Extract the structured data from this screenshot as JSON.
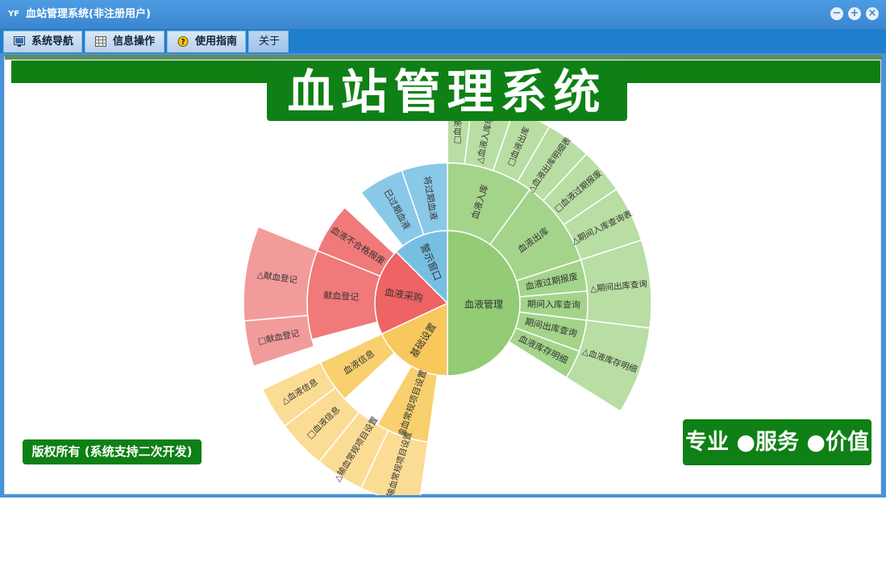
{
  "window": {
    "title": "血站管理系统(非注册用户)",
    "icon": "app-logo-icon"
  },
  "menu": [
    {
      "label": "系统导航",
      "icon": "monitor-icon"
    },
    {
      "label": "信息操作",
      "icon": "grid-icon"
    },
    {
      "label": "使用指南",
      "icon": "help-icon"
    },
    {
      "label": "关于",
      "icon": ""
    }
  ],
  "banner": {
    "title": "血站管理系统"
  },
  "footer": {
    "copyright": "版权所有 (系统支持二次开发)",
    "slogan": "专业 ●服务 ●价值"
  },
  "colors": {
    "green": "#0f8015",
    "titlebar": "#3a86cf",
    "menubar": "#1f7fcf"
  },
  "sunburst": {
    "rings": [
      {
        "level": 1,
        "segments": [
          {
            "label": "血液管理",
            "color": "#93cc74"
          },
          {
            "label": "基础设置",
            "color": "#f8c85c"
          },
          {
            "label": "血液采购",
            "color": "#ee6363"
          },
          {
            "label": "警示窗口",
            "color": "#76bfe3"
          }
        ]
      },
      {
        "level": 2,
        "segments": [
          {
            "label": "血液入库",
            "color": "#a3d48a"
          },
          {
            "label": "血液出库",
            "color": "#a3d48a"
          },
          {
            "label": "血液过期报废",
            "color": "#a3d48a"
          },
          {
            "label": "期间入库查询",
            "color": "#a3d48a"
          },
          {
            "label": "期间出库查询",
            "color": "#a3d48a"
          },
          {
            "label": "血液库存明细",
            "color": "#a3d48a"
          },
          {
            "label": "输血常规项目设置",
            "color": "#f9d06e"
          },
          {
            "label": "血液信息",
            "color": "#f9d06e"
          },
          {
            "label": "献血登记",
            "color": "#f07979"
          },
          {
            "label": "血液不合格报废",
            "color": "#f07979"
          },
          {
            "label": "已过期血液",
            "color": "#8ac8e8"
          },
          {
            "label": "将过期血液",
            "color": "#8ac8e8"
          }
        ]
      },
      {
        "level": 3,
        "segments": [
          {
            "label": "□血液",
            "color": "#b8dea3"
          },
          {
            "label": "△血液入库明细",
            "color": "#b8dea3"
          },
          {
            "label": "□血液出库",
            "color": "#b8dea3"
          },
          {
            "label": "△血液出库明细表",
            "color": "#b8dea3"
          },
          {
            "label": "□血液过期报废",
            "color": "#b8dea3"
          },
          {
            "label": "△期间入库查询表",
            "color": "#b8dea3"
          },
          {
            "label": "△期间出库查询",
            "color": "#b8dea3"
          },
          {
            "label": "△血液库存明细",
            "color": "#b8dea3"
          },
          {
            "label": "□输血常规项目设置",
            "color": "#fbdc95"
          },
          {
            "label": "△输血常规项目设置",
            "color": "#fbdc95"
          },
          {
            "label": "□血液信息",
            "color": "#fbdc95"
          },
          {
            "label": "△血液信息",
            "color": "#fbdc95"
          },
          {
            "label": "□献血登记",
            "color": "#f29b9b"
          },
          {
            "label": "△献血登记",
            "color": "#f29b9b"
          }
        ]
      }
    ]
  }
}
